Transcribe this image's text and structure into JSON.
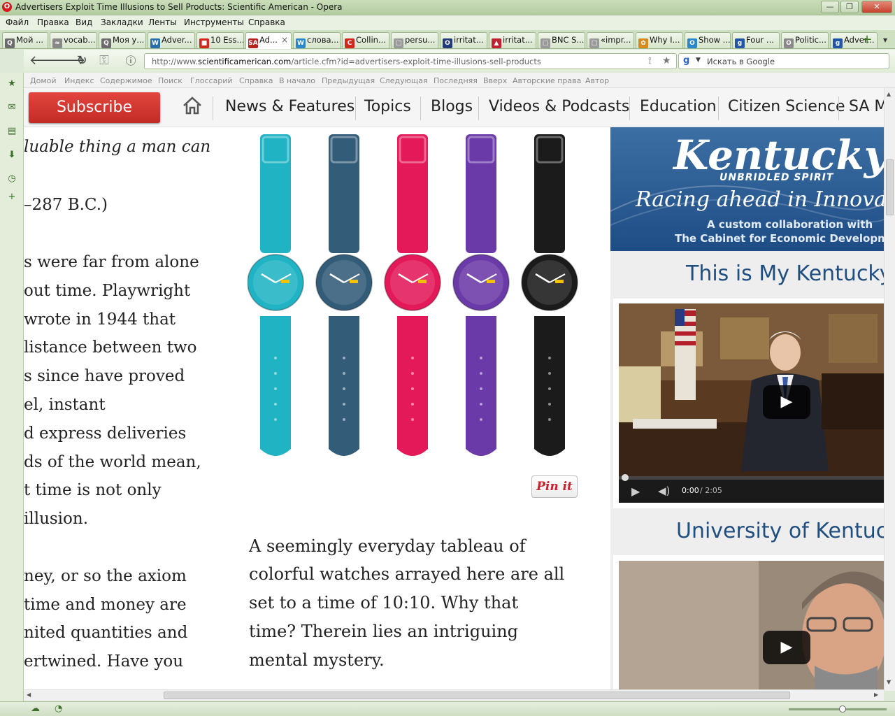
{
  "window": {
    "title": "Advertisers Exploit Time Illusions to Sell Products: Scientific American - Opera",
    "logo": "O",
    "min": "—",
    "restore": "❐",
    "close": "✕"
  },
  "menu": [
    "Файл",
    "Правка",
    "Вид",
    "Закладки",
    "Ленты",
    "Инструменты",
    "Справка"
  ],
  "tabs": [
    {
      "label": "Мой ...",
      "fav": "Q",
      "color": "#6b6b6b"
    },
    {
      "label": "vocab...",
      "fav": "≈",
      "color": "#888"
    },
    {
      "label": "Моя у...",
      "fav": "Q",
      "color": "#6b6b6b"
    },
    {
      "label": "Adver...",
      "fav": "W",
      "color": "#2a6ea8"
    },
    {
      "label": "10 Ess...",
      "fav": "■",
      "color": "#d4261c"
    },
    {
      "label": "Ad...",
      "fav": "SA",
      "color": "#b8231e",
      "active": true
    },
    {
      "label": "слова...",
      "fav": "W",
      "color": "#2a86c8"
    },
    {
      "label": "Collin...",
      "fav": "C",
      "color": "#d4261c"
    },
    {
      "label": "persu...",
      "fav": "□",
      "color": "#999"
    },
    {
      "label": "irritat...",
      "fav": "O",
      "color": "#233a7a"
    },
    {
      "label": "irritat...",
      "fav": "▲",
      "color": "#c02030"
    },
    {
      "label": "BNC S...",
      "fav": "□",
      "color": "#999"
    },
    {
      "label": "«impr...",
      "fav": "□",
      "color": "#999"
    },
    {
      "label": "Why I...",
      "fav": "✿",
      "color": "#d48a1c"
    },
    {
      "label": "Show ...",
      "fav": "O",
      "color": "#2a86c8"
    },
    {
      "label": "Four ...",
      "fav": "g",
      "color": "#2255aa"
    },
    {
      "label": "Politic...",
      "fav": "O",
      "color": "#888"
    },
    {
      "label": "Adver...",
      "fav": "g",
      "color": "#2255aa"
    }
  ],
  "newtab": "+",
  "tabmenu": "▾",
  "address": {
    "prefix": "http://www.",
    "domain": "scientificamerican.com",
    "path": "/article.cfm?id=advertisers-exploit-time-illusions-sell-products",
    "search_placeholder": "Искать в Google",
    "search_engine": "g"
  },
  "navlinks": [
    "Домой",
    "Индекс",
    "Содержимое",
    "Поиск",
    "Глоссарий",
    "Справка",
    "В начало",
    "Предыдущая",
    "Следующая",
    "Последняя",
    "Вверх",
    "Авторские права",
    "Автор"
  ],
  "site": {
    "subscribe": "Subscribe",
    "nav": [
      "News & Features",
      "Topics",
      "Blogs",
      "Videos & Podcasts",
      "Education",
      "Citizen Science",
      "SA M"
    ]
  },
  "article": {
    "lines": [
      {
        "text": "luable thing a man can",
        "italic": true
      },
      {
        "text": "–287 B.C.)"
      },
      {
        "text": "s were far from alone"
      },
      {
        "text": "out time. Playwright"
      },
      {
        "text": "wrote in 1944 that"
      },
      {
        "text": "listance between two"
      },
      {
        "text": "s since have proved"
      },
      {
        "text": "el, instant"
      },
      {
        "text": "d express deliveries"
      },
      {
        "text": "ds of the world mean,"
      },
      {
        "text": "t time is not only"
      },
      {
        "text": "illusion."
      },
      {
        "text": "ney, or so the axiom"
      },
      {
        "text": "time and money are"
      },
      {
        "text": "nited quantities and"
      },
      {
        "text": "ertwined. Have you"
      }
    ],
    "caption": [
      "A seemingly everyday tableau of",
      "colorful watches arrayed here are all",
      "set to a time of 10:10. Why that",
      "time? Therein lies an intriguing",
      "mental mystery."
    ],
    "pin": "Pin it",
    "watch_colors": [
      "#1fb3c4",
      "#335c78",
      "#e3195a",
      "#6a3aa8",
      "#1b1b1b"
    ]
  },
  "sidebar": {
    "ad": {
      "title": "Kentucky",
      "sub": "UNBRIDLED SPIRIT",
      "racing": "Racing ahead in Innova",
      "collab": "A custom collaboration with",
      "cabinet": "The Cabinet for Economic Developme"
    },
    "heading1": "This is My Kentucky",
    "heading2": "University of Kentuck",
    "video1_time": "0:00",
    "video1_duration": "/ 2:05"
  }
}
